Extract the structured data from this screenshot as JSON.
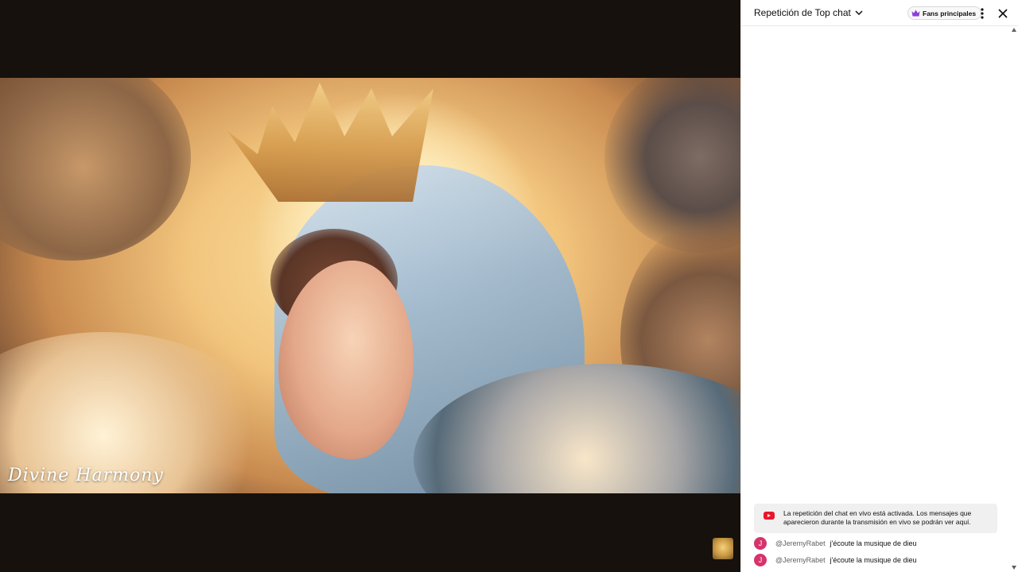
{
  "video": {
    "watermark": "Divine Harmony"
  },
  "chat": {
    "header": {
      "title": "Repetición de Top chat",
      "fans_label": "Fans principales"
    },
    "replay_notice": "La repetición del chat en vivo está activada. Los mensajes que aparecieron durante la transmisión en vivo se podrán ver aquí.",
    "messages": [
      {
        "avatar_letter": "J",
        "author": "@JeremyRabet",
        "text": "j'écoute la musique de dieu"
      },
      {
        "avatar_letter": "J",
        "author": "@JeremyRabet",
        "text": "j'écoute la musique de dieu"
      }
    ]
  },
  "colors": {
    "avatar": "#d6336c",
    "youtube_red": "#e8162d",
    "fans_crown": "#8b3fd9"
  },
  "icons": [
    "chevron-down-icon",
    "crown-icon",
    "more-vert-icon",
    "close-icon",
    "youtube-icon"
  ]
}
